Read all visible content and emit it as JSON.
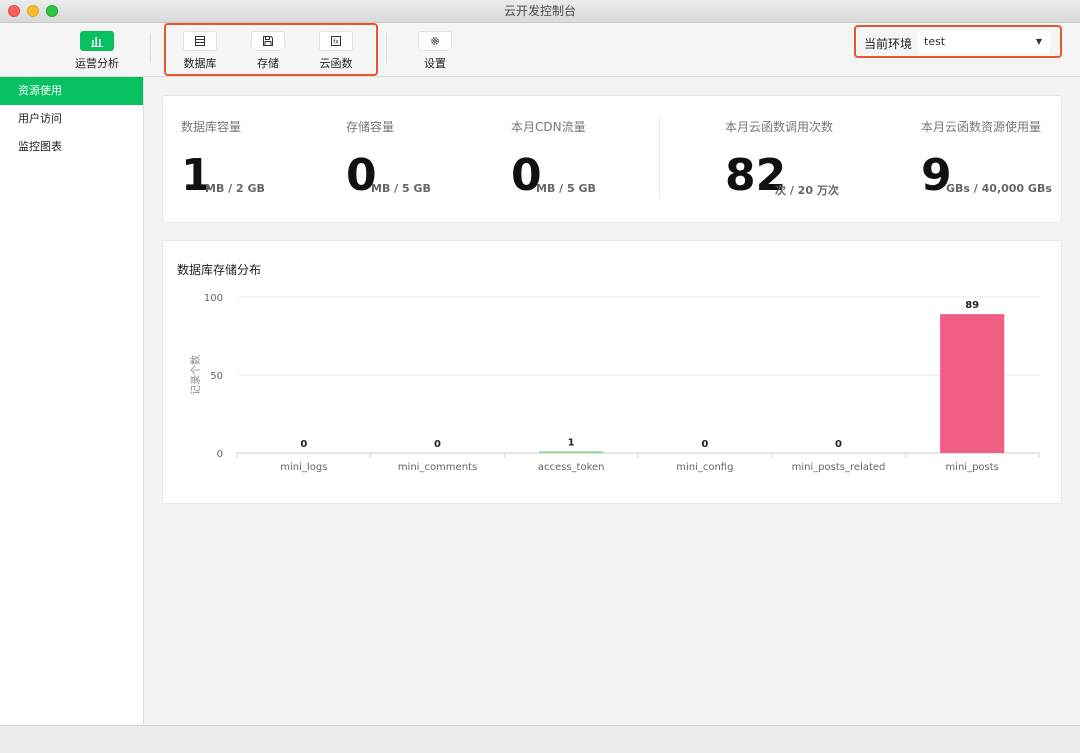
{
  "window": {
    "title": "云开发控制台"
  },
  "toolbar": {
    "analytics_label": "运营分析",
    "database_label": "数据库",
    "storage_label": "存储",
    "functions_label": "云函数",
    "settings_label": "设置",
    "env_label": "当前环境",
    "env_value": "test"
  },
  "sidebar": {
    "items": [
      {
        "label": "资源使用",
        "active": true
      },
      {
        "label": "用户访问",
        "active": false
      },
      {
        "label": "监控图表",
        "active": false
      }
    ]
  },
  "stats": [
    {
      "label": "数据库容量",
      "value": "1",
      "unit": "MB / 2 GB"
    },
    {
      "label": "存储容量",
      "value": "0",
      "unit": "MB / 5 GB"
    },
    {
      "label": "本月CDN流量",
      "value": "0",
      "unit": "MB / 5 GB"
    },
    {
      "label": "本月云函数调用次数",
      "value": "82",
      "unit": "次 / 20 万次"
    },
    {
      "label": "本月云函数资源使用量",
      "value": "9",
      "unit": "GBs / 40,000 GBs"
    }
  ],
  "colors": {
    "accent": "#07c160",
    "highlight": "#e5572e",
    "bar_main": "#f25d84",
    "bar_small": "#7ed886"
  },
  "chart_data": {
    "type": "bar",
    "title": "数据库存储分布",
    "ylabel": "记录个数",
    "xlabel": "",
    "categories": [
      "mini_logs",
      "mini_comments",
      "access_token",
      "mini_config",
      "mini_posts_related",
      "mini_posts"
    ],
    "values": [
      0,
      0,
      1,
      0,
      0,
      89
    ],
    "ylim": [
      0,
      100
    ],
    "yticks": [
      0,
      50,
      100
    ],
    "grid": true
  }
}
